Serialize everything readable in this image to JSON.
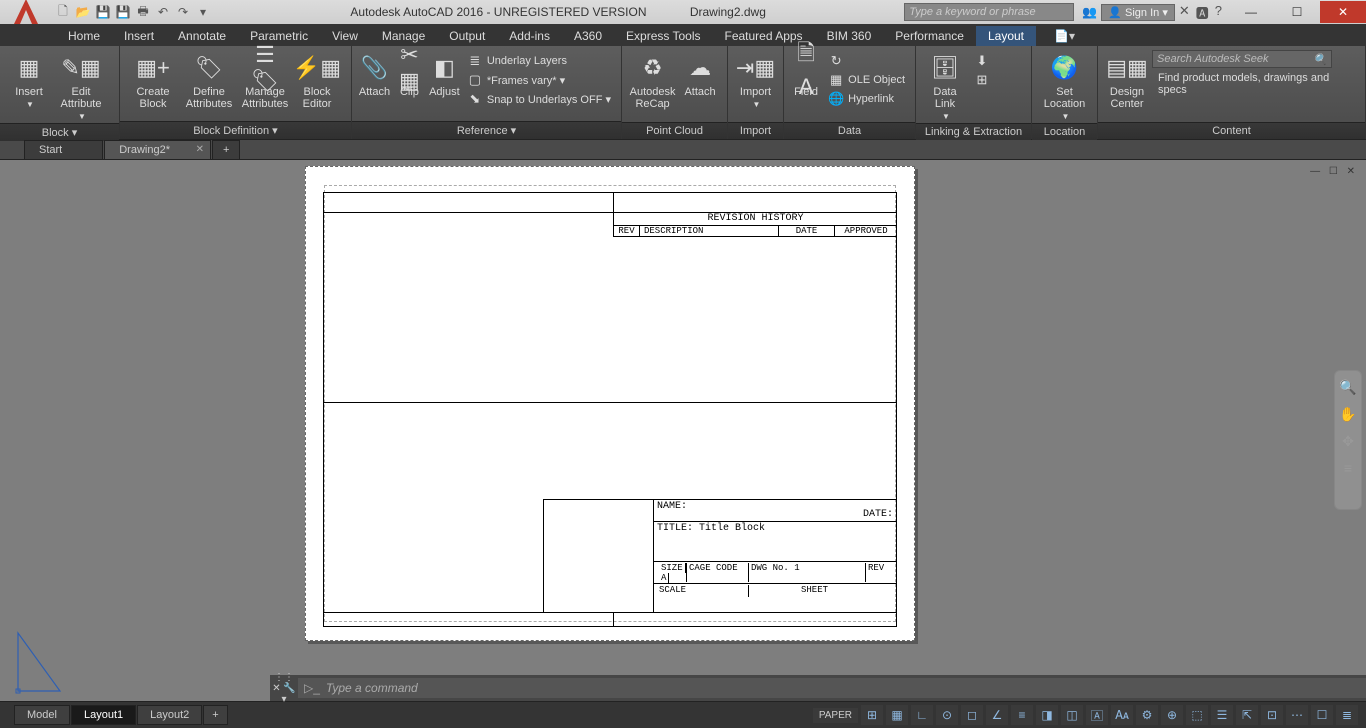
{
  "title": {
    "app": "Autodesk AutoCAD 2016 - UNREGISTERED VERSION",
    "file": "Drawing2.dwg"
  },
  "search": {
    "placeholder": "Type a keyword or phrase"
  },
  "signin": "Sign In",
  "tabs": [
    "Home",
    "Insert",
    "Annotate",
    "Parametric",
    "View",
    "Manage",
    "Output",
    "Add-ins",
    "A360",
    "Express Tools",
    "Featured Apps",
    "BIM 360",
    "Performance",
    "Layout"
  ],
  "activeTab": "Layout",
  "panels": {
    "block": {
      "title": "Block ▾",
      "insert": "Insert",
      "edit_attr": "Edit\nAttribute"
    },
    "blockdef": {
      "title": "Block Definition ▾",
      "create": "Create\nBlock",
      "define": "Define\nAttributes",
      "manage": "Manage\nAttributes",
      "editor": "Block\nEditor"
    },
    "ref": {
      "title": "Reference ▾",
      "attach": "Attach",
      "clip": "Clip",
      "adjust": "Adjust",
      "ul": "Underlay Layers",
      "frames": "*Frames vary* ▾",
      "snap": "Snap to Underlays OFF ▾"
    },
    "pc": {
      "title": "Point Cloud",
      "recap": "Autodesk\nReCap",
      "attach": "Attach"
    },
    "imp": {
      "title": "Import",
      "import": "Import"
    },
    "data": {
      "title": "Data",
      "field": "Field",
      "ole": "OLE Object",
      "hyper": "Hyperlink"
    },
    "link": {
      "title": "Linking & Extraction",
      "dl": "Data\nLink"
    },
    "loc": {
      "title": "Location",
      "set": "Set\nLocation"
    },
    "content": {
      "title": "Content",
      "dc": "Design\nCenter",
      "seek_ph": "Search Autodesk Seek",
      "seek_txt": "Find product models, drawings and specs"
    }
  },
  "file_tabs": {
    "start": "Start",
    "drawing": "Drawing2*"
  },
  "cmd": {
    "placeholder": "Type a command"
  },
  "model_tabs": {
    "model": "Model",
    "l1": "Layout1",
    "l2": "Layout2"
  },
  "status": {
    "paper": "PAPER"
  },
  "drawing": {
    "rev_title": "REVISION  HISTORY",
    "rev_cols": {
      "rev": "REV",
      "desc": "DESCRIPTION",
      "date": "DATE",
      "appr": "APPROVED"
    },
    "tb": {
      "name": "NAME:",
      "date": "DATE:",
      "title": "TITLE: Title Block",
      "size_l": "SIZE",
      "size_v": "A",
      "cage": "CAGE  CODE",
      "dwg": "DWG  No.  1",
      "rev": "REV",
      "scale": "SCALE",
      "sheet": "SHEET"
    }
  }
}
